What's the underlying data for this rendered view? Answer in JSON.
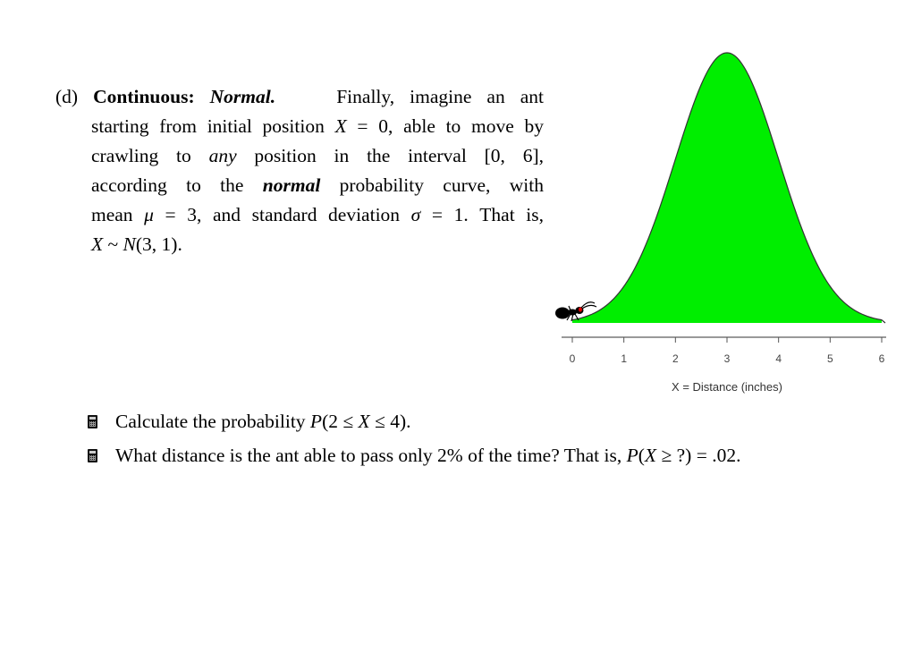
{
  "problem": {
    "label": "(d)",
    "heading_bold": "Continuous:",
    "heading_bold_italic": "Normal.",
    "lines": [
      {
        "parts": [
          {
            "t": "Finally,  imagine  an  ant",
            "s": "n"
          }
        ]
      },
      {
        "parts": [
          {
            "t": "starting from initial position ",
            "s": "n"
          },
          {
            "t": "X",
            "s": "i"
          },
          {
            "t": " = 0, able to move by",
            "s": "n"
          }
        ]
      },
      {
        "parts": [
          {
            "t": "crawling to ",
            "s": "n"
          },
          {
            "t": "any",
            "s": "i"
          },
          {
            "t": " position in the interval [0, 6],",
            "s": "n"
          }
        ]
      },
      {
        "parts": [
          {
            "t": "according to the ",
            "s": "n"
          },
          {
            "t": "normal",
            "s": "bi"
          },
          {
            "t": " probability curve, with",
            "s": "n"
          }
        ]
      },
      {
        "parts": [
          {
            "t": "mean ",
            "s": "n"
          },
          {
            "t": "μ",
            "s": "i"
          },
          {
            "t": " = 3, and standard deviation ",
            "s": "n"
          },
          {
            "t": "σ",
            "s": "i"
          },
          {
            "t": " = 1.  That is,",
            "s": "n"
          }
        ]
      },
      {
        "parts": [
          {
            "t": "X",
            "s": "i"
          },
          {
            "t": " ~ ",
            "s": "n"
          },
          {
            "t": "N",
            "s": "i"
          },
          {
            "t": "(3, 1).",
            "s": "n"
          }
        ]
      }
    ]
  },
  "tasks": [
    {
      "icon": "calculator-icon",
      "parts": [
        {
          "t": "Calculate the probability ",
          "s": "n"
        },
        {
          "t": "P",
          "s": "i"
        },
        {
          "t": "(2 ≤ ",
          "s": "n"
        },
        {
          "t": "X",
          "s": "i"
        },
        {
          "t": " ≤ 4).",
          "s": "n"
        }
      ]
    },
    {
      "icon": "calculator-icon",
      "parts": [
        {
          "t": "What distance is the ant able to pass only 2% of the time?  That is, ",
          "s": "n"
        },
        {
          "t": "P",
          "s": "i"
        },
        {
          "t": "(",
          "s": "n"
        },
        {
          "t": "X",
          "s": "i"
        },
        {
          "t": " ≥ ?) = .02.",
          "s": "n"
        }
      ]
    }
  ],
  "chart_data": {
    "type": "area",
    "title": "",
    "distribution": "normal",
    "mean": 3,
    "sd": 1,
    "x_range": [
      0,
      6
    ],
    "xlim": [
      0,
      6
    ],
    "xlabel": "X = Distance (inches)",
    "ylabel": "",
    "x_ticks": [
      "0",
      "1",
      "2",
      "3",
      "4",
      "5",
      "6"
    ],
    "fill_color": "#00ee00",
    "line_color": "#333333",
    "grid": false,
    "annotation": "ant-at-x-0"
  }
}
